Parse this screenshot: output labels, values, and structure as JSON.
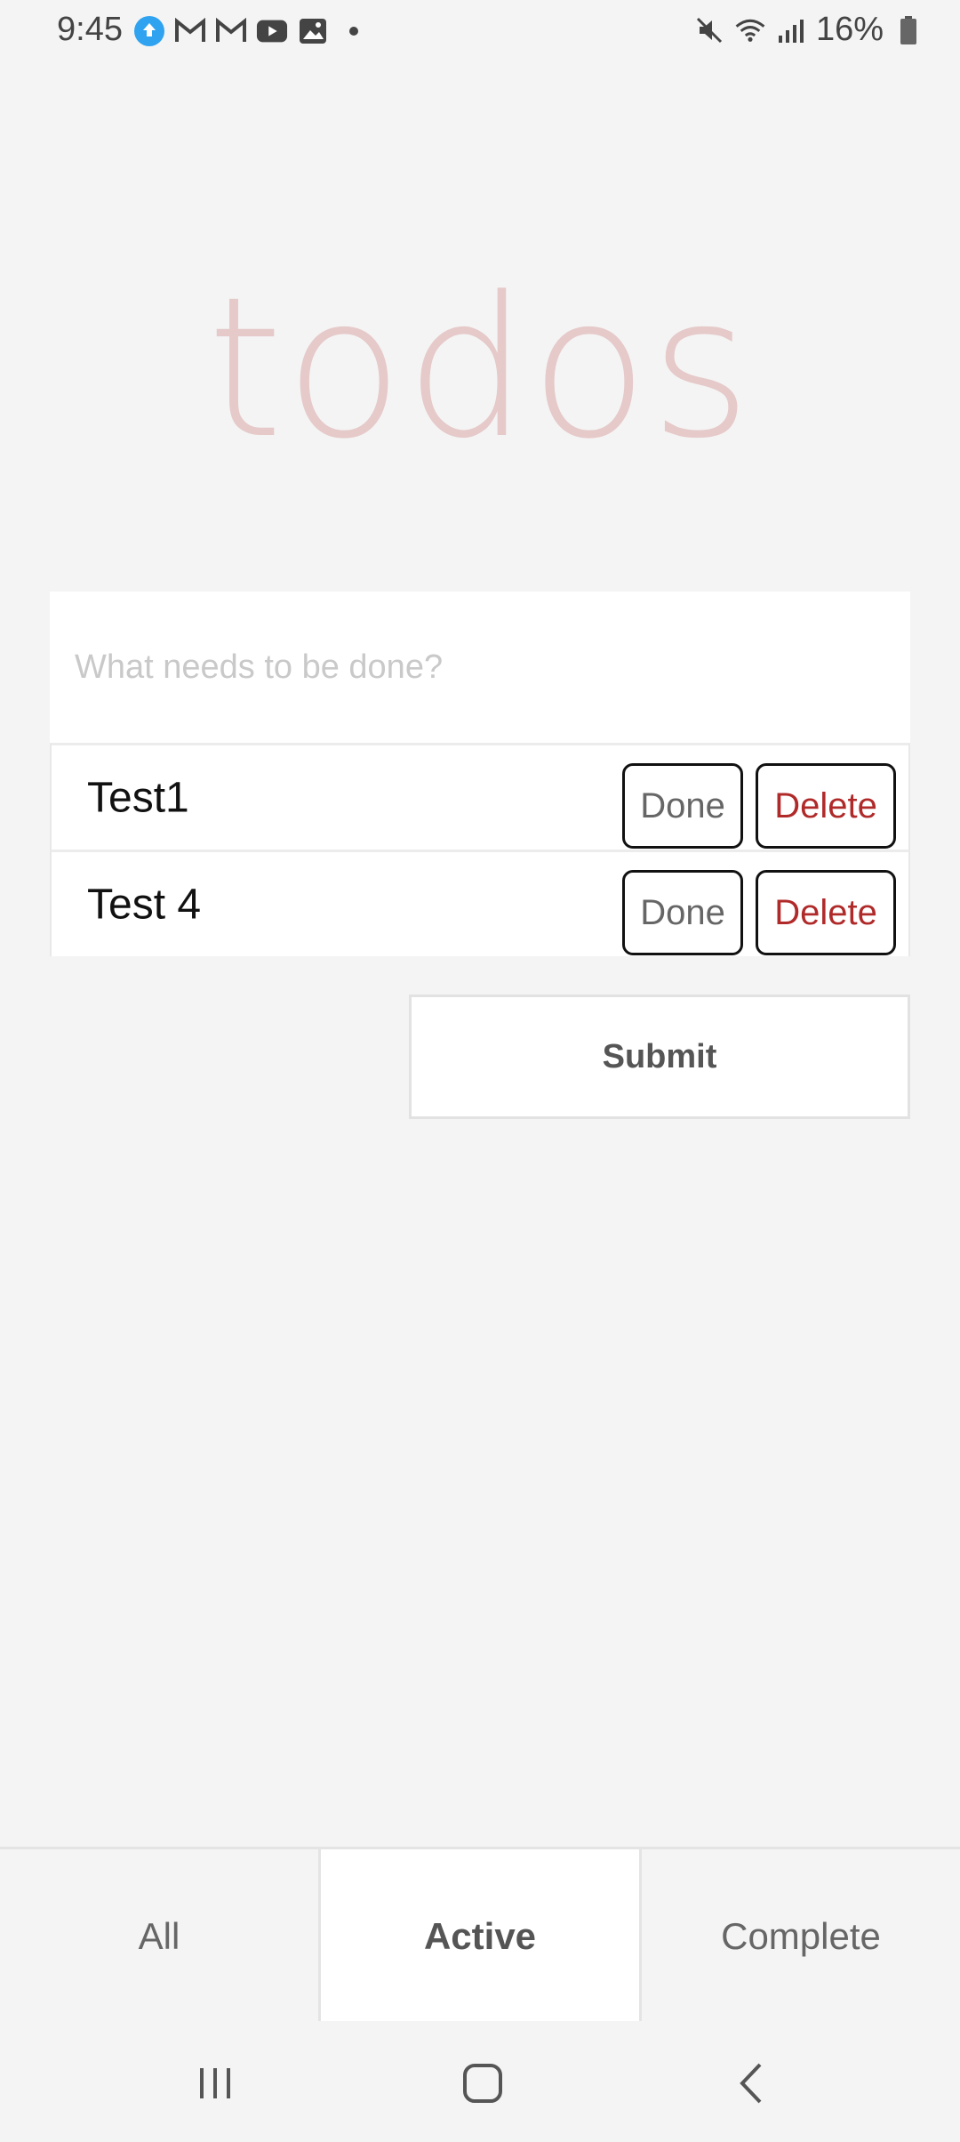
{
  "status_bar": {
    "time": "9:45",
    "battery": "16%",
    "left_icons": [
      "cloud-upload-icon",
      "gmail-icon",
      "gmail-icon",
      "youtube-icon",
      "gallery-icon",
      "dot-icon"
    ],
    "right_icons": [
      "mute-icon",
      "wifi-icon",
      "signal-icon",
      "battery-icon"
    ]
  },
  "app": {
    "title": "todos",
    "input_placeholder": "What needs to be done?",
    "todos": [
      {
        "label": "Test1",
        "done_label": "Done",
        "delete_label": "Delete"
      },
      {
        "label": "Test 4",
        "done_label": "Done",
        "delete_label": "Delete"
      }
    ],
    "submit_label": "Submit"
  },
  "filters": {
    "tabs": [
      {
        "label": "All",
        "active": false
      },
      {
        "label": "Active",
        "active": true
      },
      {
        "label": "Complete",
        "active": false
      }
    ]
  },
  "nav": {
    "icons": [
      "recent-apps-icon",
      "home-icon",
      "back-icon"
    ]
  },
  "colors": {
    "title": "#e6c9c9",
    "delete": "#b02a2a",
    "background": "#f4f4f4"
  }
}
